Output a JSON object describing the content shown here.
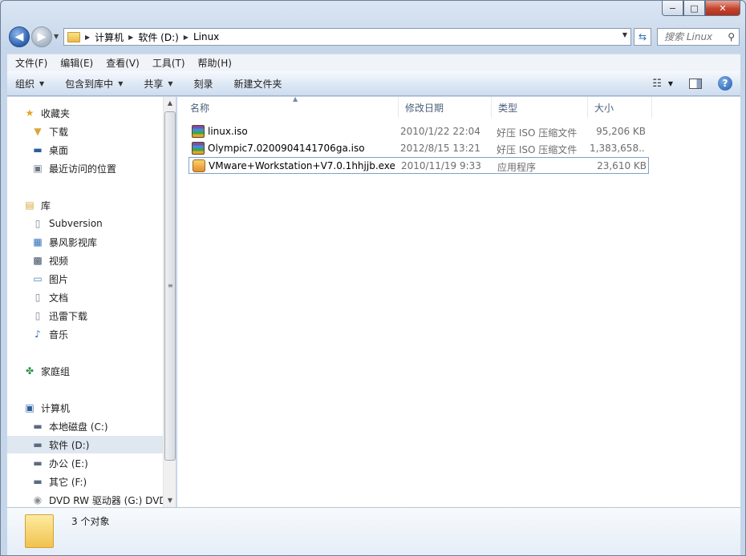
{
  "window": {
    "caption_buttons": [
      "−",
      "□",
      "✕"
    ]
  },
  "address": {
    "crumbs": [
      "计算机",
      "软件 (D:)",
      "Linux"
    ],
    "search_placeholder": "搜索 Linux"
  },
  "menu": [
    "文件(F)",
    "编辑(E)",
    "查看(V)",
    "工具(T)",
    "帮助(H)"
  ],
  "toolbar": {
    "organize": "组织",
    "include_in_library": "包含到库中",
    "share": "共享",
    "burn": "刻录",
    "new_folder": "新建文件夹"
  },
  "nav_pane": {
    "favorites": {
      "label": "收藏夹",
      "items": [
        "下载",
        "桌面",
        "最近访问的位置"
      ]
    },
    "libraries": {
      "label": "库",
      "items": [
        "Subversion",
        "暴风影视库",
        "视频",
        "图片",
        "文档",
        "迅雷下载",
        "音乐"
      ]
    },
    "homegroup": "家庭组",
    "computer": {
      "label": "计算机",
      "items": [
        "本地磁盘 (C:)",
        "软件 (D:)",
        "办公 (E:)",
        "其它 (F:)",
        "DVD RW 驱动器 (G:) DVD"
      ]
    },
    "selected": "软件 (D:)"
  },
  "columns": [
    "名称",
    "修改日期",
    "类型",
    "大小"
  ],
  "files": [
    {
      "name": "linux.iso",
      "date": "2010/1/22 22:04",
      "type": "好压 ISO 压缩文件",
      "size": "95,206 KB",
      "icon": "archive-icon"
    },
    {
      "name": "Olympic7.0200904141706ga.iso",
      "date": "2012/8/15 13:21",
      "type": "好压 ISO 压缩文件",
      "size": "1,383,658...",
      "icon": "archive-icon"
    },
    {
      "name": "VMware+Workstation+V7.0.1hhjjb.exe",
      "date": "2010/11/19 9:33",
      "type": "应用程序",
      "size": "23,610 KB",
      "icon": "application-icon"
    }
  ],
  "status": {
    "item_count": "3 个对象"
  }
}
